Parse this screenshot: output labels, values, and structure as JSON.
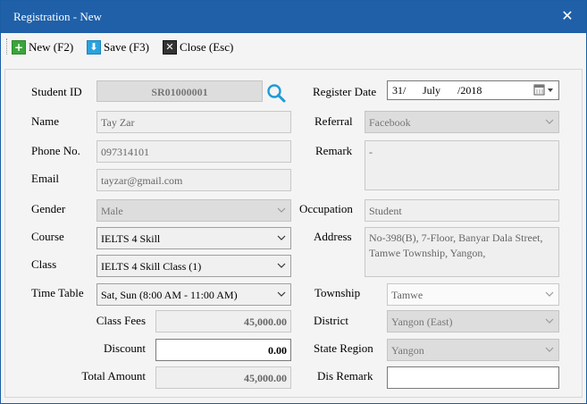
{
  "window": {
    "title": "Registration - New",
    "close_glyph": "✕"
  },
  "toolbar": {
    "new_label": "New (F2)",
    "save_label": "Save (F3)",
    "close_label": "Close (Esc)",
    "new_glyph": "+",
    "save_glyph": "⬇",
    "close_glyph": "✕"
  },
  "form": {
    "student_id": {
      "label": "Student ID",
      "value": "SR01000001"
    },
    "register_date": {
      "label": "Register Date",
      "day": "31/",
      "month": "July",
      "year": "/2018"
    },
    "name": {
      "label": "Name",
      "value": "Tay Zar"
    },
    "referral": {
      "label": "Referral",
      "value": "Facebook"
    },
    "phone": {
      "label": "Phone No.",
      "value": "097314101"
    },
    "remark": {
      "label": "Remark",
      "value": "-"
    },
    "email": {
      "label": "Email",
      "value": "tayzar@gmail.com"
    },
    "gender": {
      "label": "Gender",
      "value": "Male"
    },
    "occupation": {
      "label": "Occupation",
      "value": "Student"
    },
    "course": {
      "label": "Course",
      "value": "IELTS 4 Skill"
    },
    "address": {
      "label": "Address",
      "value": "No-398(B), 7-Floor, Banyar Dala Street, Tamwe Township, Yangon,"
    },
    "class": {
      "label": "Class",
      "value": "IELTS 4 Skill Class (1)"
    },
    "time_table": {
      "label": "Time Table",
      "value": "Sat, Sun (8:00 AM - 11:00 AM)"
    },
    "township": {
      "label": "Township",
      "value": "Tamwe"
    },
    "class_fees": {
      "label": "Class Fees",
      "value": "45,000.00"
    },
    "district": {
      "label": "District",
      "value": "Yangon (East)"
    },
    "discount": {
      "label": "Discount",
      "value": "0.00"
    },
    "state_region": {
      "label": "State Region",
      "value": "Yangon"
    },
    "total_amount": {
      "label": "Total Amount",
      "value": "45,000.00"
    },
    "dis_remark": {
      "label": "Dis Remark",
      "value": ""
    }
  },
  "colors": {
    "titlebar": "#1f60a8",
    "accent_icon": "#1e9bd7"
  }
}
